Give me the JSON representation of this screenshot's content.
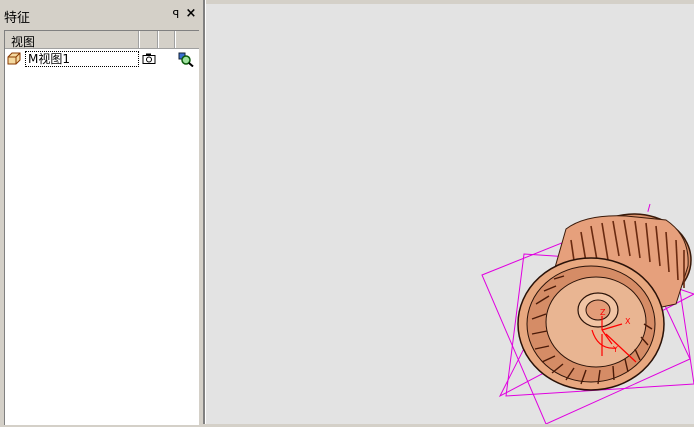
{
  "panel": {
    "title": "特征",
    "pin_glyph": "ꟼ",
    "close_glyph": "×"
  },
  "tree": {
    "column_header": "视图",
    "rows": [
      {
        "name": "M视图1",
        "icon": "view-box-icon",
        "camera_icon": "camera-icon",
        "action_icon": "zoom-magnifier-icon"
      }
    ]
  },
  "viewport": {
    "background": "#e3e3e3",
    "model_color": "#e8a07a",
    "plane_color": "#e000e0",
    "axis_color": "#ff0000",
    "axis_labels": [
      "Z",
      "X",
      "Y"
    ]
  }
}
